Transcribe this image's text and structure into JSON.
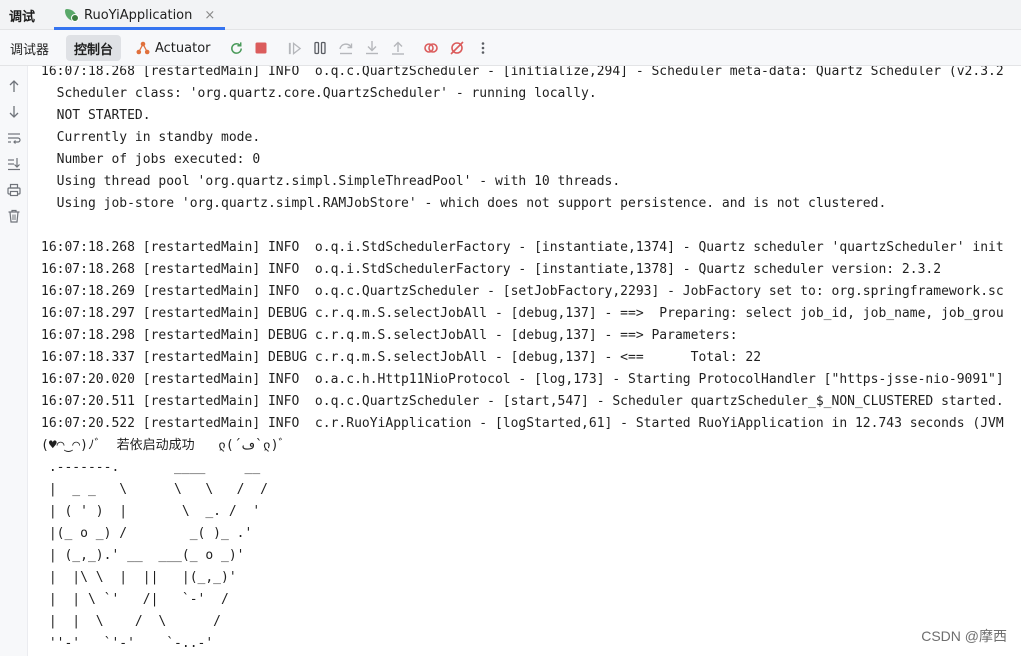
{
  "top_tabs": {
    "debug_label": "调试",
    "app_tab_label": "RuoYiApplication",
    "close_symbol": "×"
  },
  "toolbar": {
    "debugger_label": "调试器",
    "console_label": "控制台",
    "actuator_label": "Actuator",
    "icons": [
      "rerun-icon",
      "stop-icon",
      "resume-icon",
      "pause-icon",
      "step-over-icon",
      "step-into-icon",
      "step-out-icon",
      "view-breakpoints-icon",
      "mute-breakpoints-icon",
      "more-icon"
    ]
  },
  "sidebar": {
    "icons": [
      "scroll-up-icon",
      "scroll-down-icon",
      "soft-wrap-icon",
      "scroll-to-end-icon",
      "print-icon",
      "clear-icon"
    ]
  },
  "console": {
    "lines": [
      "16:07:18.268 [restartedMain] INFO  o.q.c.QuartzScheduler - [initialize,294] - Scheduler meta-data: Quartz Scheduler (v2.3.2",
      "  Scheduler class: 'org.quartz.core.QuartzScheduler' - running locally.",
      "  NOT STARTED.",
      "  Currently in standby mode.",
      "  Number of jobs executed: 0",
      "  Using thread pool 'org.quartz.simpl.SimpleThreadPool' - with 10 threads.",
      "  Using job-store 'org.quartz.simpl.RAMJobStore' - which does not support persistence. and is not clustered.",
      "",
      "16:07:18.268 [restartedMain] INFO  o.q.i.StdSchedulerFactory - [instantiate,1374] - Quartz scheduler 'quartzScheduler' init",
      "16:07:18.268 [restartedMain] INFO  o.q.i.StdSchedulerFactory - [instantiate,1378] - Quartz scheduler version: 2.3.2",
      "16:07:18.269 [restartedMain] INFO  o.q.c.QuartzScheduler - [setJobFactory,2293] - JobFactory set to: org.springframework.sc",
      "16:07:18.297 [restartedMain] DEBUG c.r.q.m.S.selectJobAll - [debug,137] - ==>  Preparing: select job_id, job_name, job_grou",
      "16:07:18.298 [restartedMain] DEBUG c.r.q.m.S.selectJobAll - [debug,137] - ==> Parameters: ",
      "16:07:18.337 [restartedMain] DEBUG c.r.q.m.S.selectJobAll - [debug,137] - <==      Total: 22",
      "16:07:20.020 [restartedMain] INFO  o.a.c.h.Http11NioProtocol - [log,173] - Starting ProtocolHandler [\"https-jsse-nio-9091\"]",
      "16:07:20.511 [restartedMain] INFO  o.q.c.QuartzScheduler - [start,547] - Scheduler quartzScheduler_$_NON_CLUSTERED started.",
      "16:07:20.522 [restartedMain] INFO  c.r.RuoYiApplication - [logStarted,61] - Started RuoYiApplication in 12.743 seconds (JVM",
      "(♥◠‿◠)ﾉﾞ  若依启动成功   ლ(´ڡ`ლ)ﾞ",
      " .-------.       ____     __",
      " |  _ _   \\      \\   \\   /  /",
      " | ( ' )  |       \\  _. /  '",
      " |(_ o _) /        _( )_ .'",
      " | (_,_).' __  ___(_ o _)'",
      " |  |\\ \\  |  ||   |(_,_)'",
      " |  | \\ `'   /|   `-'  /",
      " |  |  \\    /  \\      /",
      " ''-'   `'-'    `-..-'"
    ]
  },
  "watermark": "CSDN @摩西"
}
